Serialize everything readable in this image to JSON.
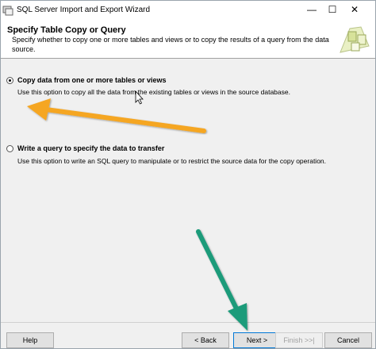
{
  "window": {
    "title": "SQL Server Import and Export Wizard"
  },
  "titlebar_buttons": {
    "minimize": "—",
    "maximize": "☐",
    "close": "✕"
  },
  "header": {
    "title": "Specify Table Copy or Query",
    "subtitle": "Specify whether to copy one or more tables and views or to copy the results of a query from the data source."
  },
  "options": [
    {
      "label": "Copy data from one or more tables or views",
      "description": "Use this option to copy all the data from the existing tables or views in the source database.",
      "selected": true
    },
    {
      "label": "Write a query to specify the data to transfer",
      "description": "Use this option to write an SQL query to manipulate or to restrict the source data for the copy operation.",
      "selected": false
    }
  ],
  "footer": {
    "help": "Help",
    "back": "< Back",
    "next": "Next >",
    "finish": "Finish >>|",
    "cancel": "Cancel"
  },
  "colors": {
    "orange_arrow": "#f5a623",
    "green_arrow": "#1a9b7a",
    "accent": "#0078d7"
  }
}
